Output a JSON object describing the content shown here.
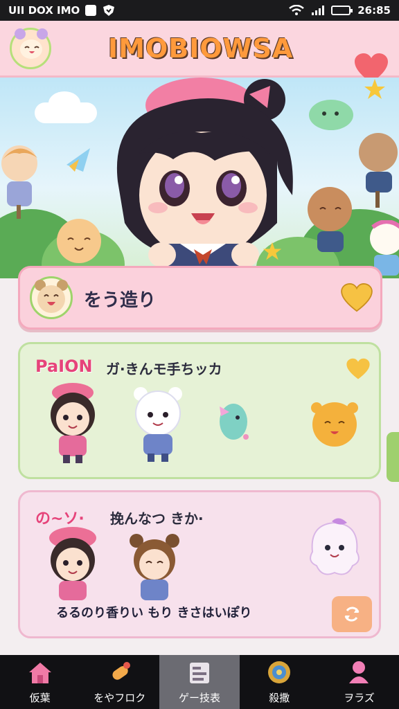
{
  "status_bar": {
    "left_text": "UII DOX IMO",
    "time": "26:85"
  },
  "header": {
    "app_title": "IMOBIOWSA",
    "avatar_icon": "bear-face-icon",
    "favorite_icon": "heart-icon",
    "colors": {
      "background": "#fbd6df",
      "heart": "#f2656e"
    }
  },
  "featured": {
    "title": "をう造り",
    "heart_icon": "heart-icon"
  },
  "card_green": {
    "title_a": "PaION",
    "title_b": "ガ·きんモ手ちッカ",
    "heart_icon": "heart-icon"
  },
  "card_pink": {
    "title_a": "の~ソ·",
    "title_b": "挽んなつ きか·",
    "caption": "るるのり香りい もり きさはいぽり",
    "refresh_icon": "refresh-icon"
  },
  "bottom_nav": {
    "items": [
      {
        "label": "仮葉",
        "icon": "home-icon"
      },
      {
        "label": "をやフロク",
        "icon": "candy-icon"
      },
      {
        "label": "ゲー技表",
        "icon": "notebook-icon"
      },
      {
        "label": "殺撒",
        "icon": "medal-icon"
      },
      {
        "label": "ヲラズ",
        "icon": "profile-icon"
      }
    ],
    "active_index": 2
  }
}
